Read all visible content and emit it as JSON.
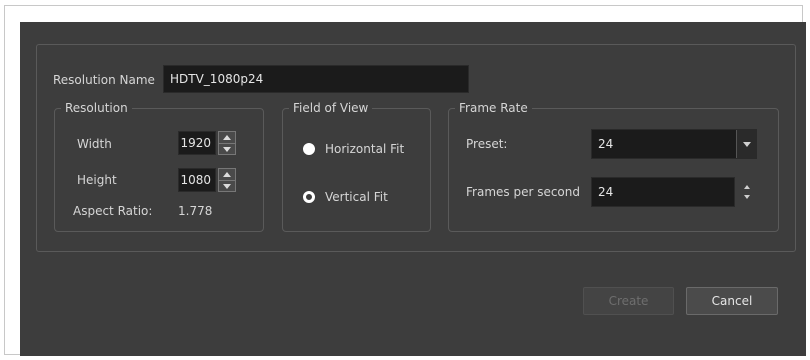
{
  "dialog": {
    "resolution_name_label": "Resolution Name",
    "resolution_name_value": "HDTV_1080p24",
    "resolution": {
      "title": "Resolution",
      "width_label": "Width",
      "width_value": "1920",
      "height_label": "Height",
      "height_value": "1080",
      "aspect_label": "Aspect Ratio:",
      "aspect_value": "1.778"
    },
    "field_of_view": {
      "title": "Field of View",
      "options": [
        "Horizontal Fit",
        "Vertical Fit"
      ],
      "selected": "Vertical Fit"
    },
    "frame_rate": {
      "title": "Frame Rate",
      "preset_label": "Preset:",
      "preset_value": "24",
      "fps_label": "Frames per second",
      "fps_value": "24"
    },
    "buttons": {
      "create_label": "Create",
      "cancel_label": "Cancel"
    }
  },
  "icons": {
    "spin_up": "triangle-up-icon",
    "spin_down": "triangle-down-icon",
    "dropdown": "chevron-down-icon"
  },
  "colors": {
    "dialog_bg": "#3d3d3d",
    "input_bg": "#1b1b1b",
    "text": "#d8d8d8"
  }
}
